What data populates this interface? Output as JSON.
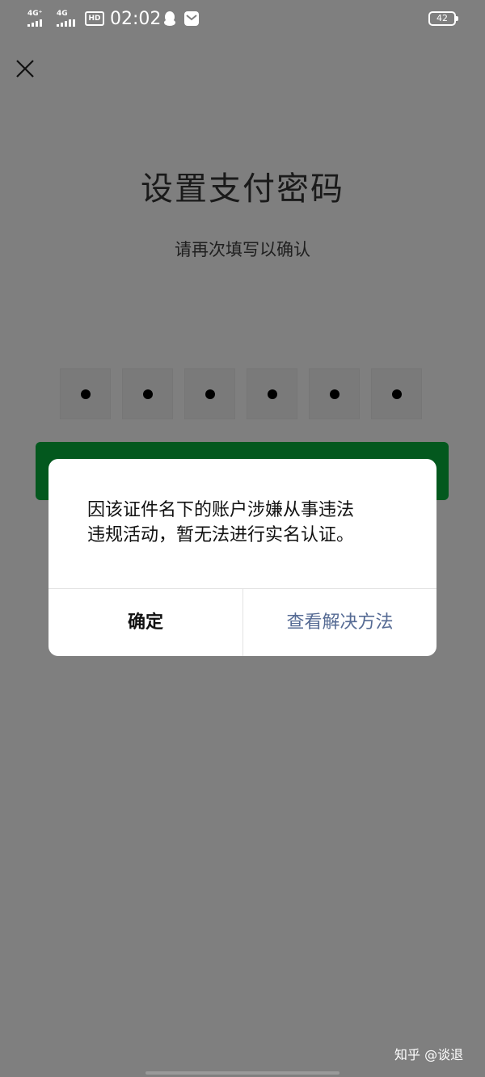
{
  "status_bar": {
    "sim1_network": "4G⁺",
    "sim2_network": "4G",
    "hd_label": "HD",
    "time": "02:02",
    "battery": "42"
  },
  "page": {
    "title": "设置支付密码",
    "subtitle": "请再次填写以确认",
    "pin_length": 6,
    "pin_filled": 6
  },
  "dialog": {
    "message": "因该证件名下的账户涉嫌从事违法\n违规活动，暂无法进行实名认证。",
    "confirm_label": "确定",
    "solution_label": "查看解决方法"
  },
  "watermark": "知乎 @谈退",
  "colors": {
    "overlay": "#7f7f7f",
    "primary_button": "#03581e",
    "link": "#566b94"
  }
}
